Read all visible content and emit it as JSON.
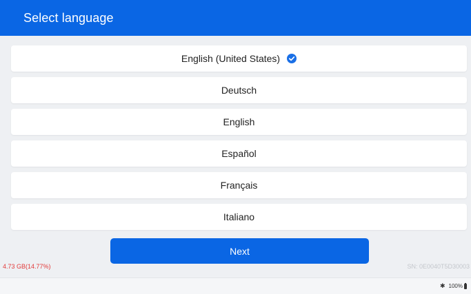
{
  "header": {
    "title": "Select language"
  },
  "languages": [
    {
      "label": "English (United States)",
      "selected": true
    },
    {
      "label": "Deutsch",
      "selected": false
    },
    {
      "label": "English",
      "selected": false
    },
    {
      "label": "Español",
      "selected": false
    },
    {
      "label": "Français",
      "selected": false
    },
    {
      "label": "Italiano",
      "selected": false
    }
  ],
  "next_button": {
    "label": "Next"
  },
  "footer": {
    "storage": "4.73 GB(14.77%)",
    "serial": "SN: 0E0040T5D30003"
  },
  "statusbar": {
    "battery": "100%",
    "bluetooth_icon": "bluetooth-icon",
    "battery_icon": "battery-icon"
  },
  "colors": {
    "accent": "#0a66e4",
    "storage_text": "#e23a3a"
  },
  "icons": {
    "check": "check-circle-icon"
  }
}
